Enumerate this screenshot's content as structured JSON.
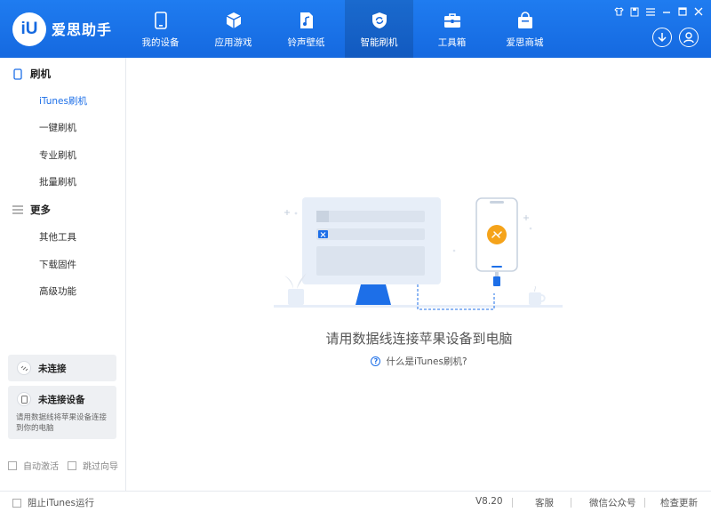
{
  "app": {
    "logo_text": "爱思助手",
    "logo_mark": "iU"
  },
  "nav": {
    "items": [
      {
        "label": "我的设备",
        "icon": "phone-icon"
      },
      {
        "label": "应用游戏",
        "icon": "cube-icon"
      },
      {
        "label": "铃声壁纸",
        "icon": "music-file-icon"
      },
      {
        "label": "智能刷机",
        "icon": "refresh-shield-icon",
        "active": true
      },
      {
        "label": "工具箱",
        "icon": "toolbox-icon"
      },
      {
        "label": "爱思商城",
        "icon": "shopping-bag-icon"
      }
    ]
  },
  "window_controls": [
    "shirt-icon",
    "note-icon",
    "menu-icon",
    "minimize-icon",
    "maximize-icon",
    "close-icon"
  ],
  "sidebar": {
    "flash_title": "刷机",
    "flash_items": [
      {
        "label": "iTunes刷机",
        "active": true
      },
      {
        "label": "一键刷机"
      },
      {
        "label": "专业刷机"
      },
      {
        "label": "批量刷机"
      }
    ],
    "more_title": "更多",
    "more_items": [
      {
        "label": "其他工具"
      },
      {
        "label": "下载固件"
      },
      {
        "label": "高级功能"
      }
    ],
    "status": {
      "connection": "未连接",
      "device": "未连接设备",
      "device_hint": "请用数据线将苹果设备连接到你的电脑"
    },
    "auto_activate": "自动激活",
    "skip_guide": "跳过向导"
  },
  "main": {
    "message": "请用数据线连接苹果设备到电脑",
    "help_link": "什么是iTunes刷机?"
  },
  "bottom": {
    "block_itunes": "阻止iTunes运行",
    "version": "V8.20",
    "support": "客服",
    "wechat": "微信公众号",
    "update": "检查更新"
  },
  "colors": {
    "primary": "#1569e0",
    "accent_orange": "#f5a31a",
    "active_link": "#1d6fe8"
  }
}
